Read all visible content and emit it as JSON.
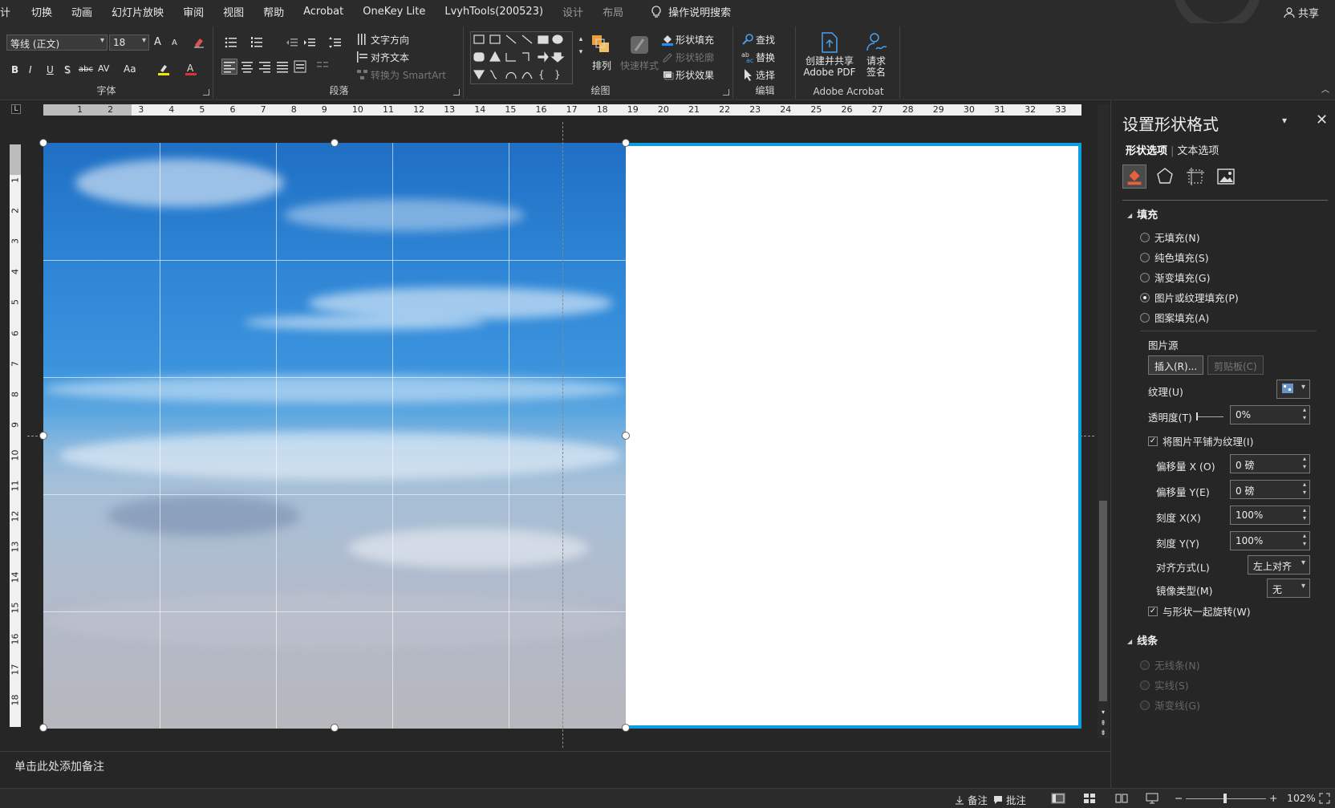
{
  "menu": {
    "first": "计",
    "tabs": [
      "切换",
      "动画",
      "幻灯片放映",
      "审阅",
      "视图",
      "帮助",
      "Acrobat",
      "OneKey Lite",
      "LvyhTools(200523)"
    ],
    "context_tabs": [
      "设计",
      "布局"
    ],
    "search_label": "操作说明搜索",
    "share_label": "共享"
  },
  "ribbon": {
    "font": {
      "font_name": "等线 (正文)",
      "font_size": "18",
      "bold": "B",
      "italic": "I",
      "underline": "U",
      "shadow": "S",
      "strike": "abc",
      "spacing": "AV",
      "case": "Aa",
      "grow": "A",
      "shrink": "A",
      "label": "字体"
    },
    "paragraph": {
      "text_direction": "文字方向",
      "align_text": "对齐文本",
      "smartart": "转换为 SmartArt",
      "label": "段落"
    },
    "drawing": {
      "arrange": "排列",
      "quick_styles": "快速样式",
      "shape_fill": "形状填充",
      "shape_outline": "形状轮廓",
      "shape_effects": "形状效果",
      "label": "绘图"
    },
    "editing": {
      "find": "查找",
      "replace": "替换",
      "select": "选择",
      "label": "编辑"
    },
    "acrobat": {
      "create_share_1": "创建并共享",
      "create_share_2": "Adobe PDF",
      "request_sign_1": "请求",
      "request_sign_2": "签名",
      "label": "Adobe Acrobat"
    }
  },
  "ruler": {
    "h_ticks": [
      "1",
      "2",
      "3",
      "4",
      "5",
      "6",
      "7",
      "8",
      "9",
      "10",
      "11",
      "12",
      "13",
      "14",
      "15",
      "16",
      "17",
      "18",
      "19",
      "20",
      "21",
      "22",
      "23",
      "24",
      "25",
      "26",
      "27",
      "28",
      "29",
      "30",
      "31",
      "32",
      "33"
    ],
    "v_ticks": [
      "1",
      "2",
      "3",
      "4",
      "5",
      "6",
      "7",
      "8",
      "9",
      "10",
      "11",
      "12",
      "13",
      "14",
      "15",
      "16",
      "17",
      "18"
    ]
  },
  "notes": {
    "placeholder": "单击此处添加备注"
  },
  "pane": {
    "title": "设置形状格式",
    "tab_shape": "形状选项",
    "tab_text": "文本选项",
    "fill_section": "填充",
    "fill_options": [
      {
        "label": "无填充(N)",
        "selected": false
      },
      {
        "label": "纯色填充(S)",
        "selected": false
      },
      {
        "label": "渐变填充(G)",
        "selected": false
      },
      {
        "label": "图片或纹理填充(P)",
        "selected": true
      },
      {
        "label": "图案填充(A)",
        "selected": false
      }
    ],
    "picture_source": "图片源",
    "insert_btn": "插入(R)...",
    "clipboard_btn": "剪贴板(C)",
    "texture_label": "纹理(U)",
    "transparency_label": "透明度(T)",
    "transparency_value": "0%",
    "tile_label": "将图片平铺为纹理(I)",
    "offset_x_label": "偏移量 X (O)",
    "offset_x_value": "0 磅",
    "offset_y_label": "偏移量 Y(E)",
    "offset_y_value": "0 磅",
    "scale_x_label": "刻度 X(X)",
    "scale_x_value": "100%",
    "scale_y_label": "刻度 Y(Y)",
    "scale_y_value": "100%",
    "align_label": "对齐方式(L)",
    "align_value": "左上对齐",
    "mirror_label": "镜像类型(M)",
    "mirror_value": "无",
    "rotate_label": "与形状一起旋转(W)",
    "line_section": "线条",
    "line_options": [
      "无线条(N)",
      "实线(S)",
      "渐变线(G)"
    ]
  },
  "status": {
    "notes": "备注",
    "comments": "批注",
    "zoom_minus": "−",
    "zoom_plus": "+",
    "zoom": "102%"
  },
  "colors": {
    "accent": "#0a9ee0",
    "ribbon_bg": "#2b2b2b",
    "app_bg": "#262626"
  }
}
